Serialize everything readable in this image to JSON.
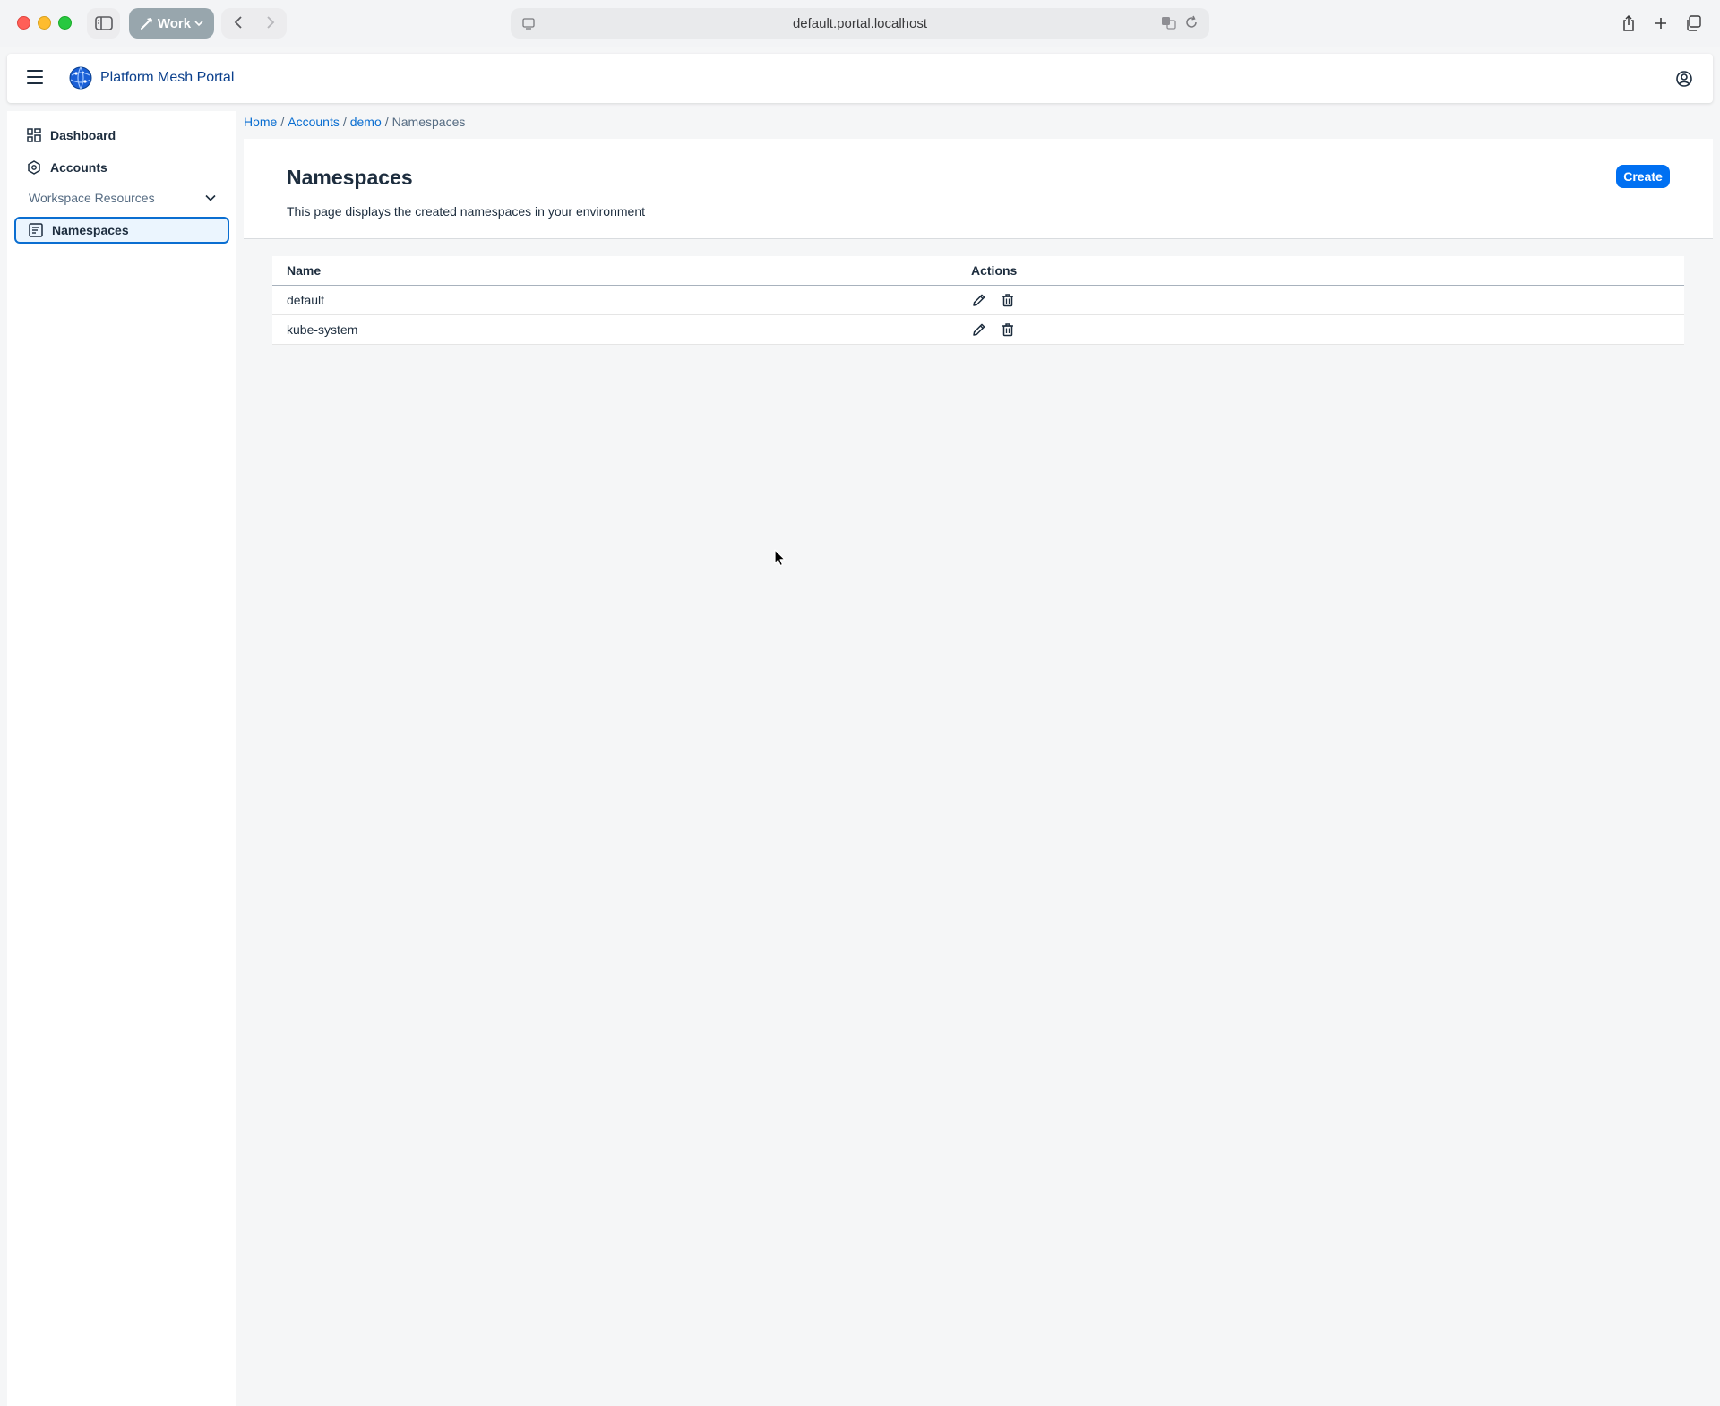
{
  "browser": {
    "profile_label": "Work",
    "url": "default.portal.localhost"
  },
  "shell": {
    "title": "Platform Mesh Portal"
  },
  "sidebar": {
    "items": [
      {
        "label": "Dashboard",
        "icon": "dashboard-icon"
      },
      {
        "label": "Accounts",
        "icon": "accounts-icon"
      }
    ],
    "group_label": "Workspace Resources",
    "group_items": [
      {
        "label": "Namespaces",
        "icon": "namespaces-icon",
        "selected": true
      }
    ]
  },
  "breadcrumb": {
    "items": [
      "Home",
      "Accounts",
      "demo"
    ],
    "separator": "/",
    "current": "Namespaces"
  },
  "page": {
    "title": "Namespaces",
    "description": "This page displays the created namespaces in your environment",
    "create_label": "Create"
  },
  "table": {
    "columns": [
      "Name",
      "Actions"
    ],
    "rows": [
      {
        "name": "default",
        "actions": [
          "edit-icon",
          "delete-icon"
        ]
      },
      {
        "name": "kube-system",
        "actions": [
          "edit-icon",
          "delete-icon"
        ]
      }
    ]
  },
  "colors": {
    "accent": "#0070f2",
    "link": "#0a6ed1",
    "title": "#0a3f8c"
  }
}
